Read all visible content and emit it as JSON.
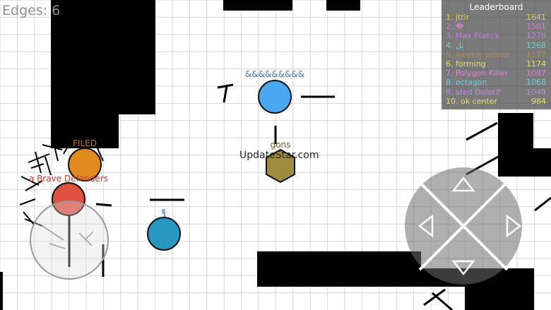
{
  "hud": {
    "edges_label": "Edges: 6"
  },
  "leaderboard": {
    "title": "Leaderboard",
    "entries": [
      {
        "rank": "1.",
        "name": "jttir",
        "score": "1641",
        "color": "#d8d050"
      },
      {
        "rank": "2.",
        "name": "�",
        "score": "1501",
        "color": "#d080d0"
      },
      {
        "rank": "3.",
        "name": "Max Planck",
        "score": "1278",
        "color": "#c080e0"
      },
      {
        "rank": "4.",
        "name": "یل",
        "score": "1268",
        "color": "#70d0d0"
      },
      {
        "rank": "5.",
        "name": "weekly prison",
        "score": "1177",
        "color": "#b09050"
      },
      {
        "rank": "6.",
        "name": "forming",
        "score": "1174",
        "color": "#e0e070"
      },
      {
        "rank": "7.",
        "name": "Polygon Killer",
        "score": "1087",
        "color": "#e080e0"
      },
      {
        "rank": "8.",
        "name": "octagon",
        "score": "1068",
        "color": "#70d0e0"
      },
      {
        "rank": "9.",
        "name": "sted Dolotif",
        "score": "1049",
        "color": "#c090e0"
      },
      {
        "rank": "10.",
        "name": "ok center",
        "score": "984",
        "color": "#e0e070"
      }
    ]
  },
  "players": {
    "top_blue": {
      "name": "&&&&&&&&&",
      "color": "#4aa8f0"
    },
    "hexagon": {
      "name": "gons",
      "color": "#a08c40"
    },
    "orange": {
      "name": "FILED",
      "color": "#e08a20"
    },
    "red": {
      "name": "a Brave Defenders",
      "color": "#e05040"
    },
    "teal": {
      "name": "ร็",
      "color": "#2898c0"
    }
  },
  "watermark": "UpdateStar.com",
  "colors": {
    "grid": "#d6d6d6",
    "wall": "#000000"
  }
}
